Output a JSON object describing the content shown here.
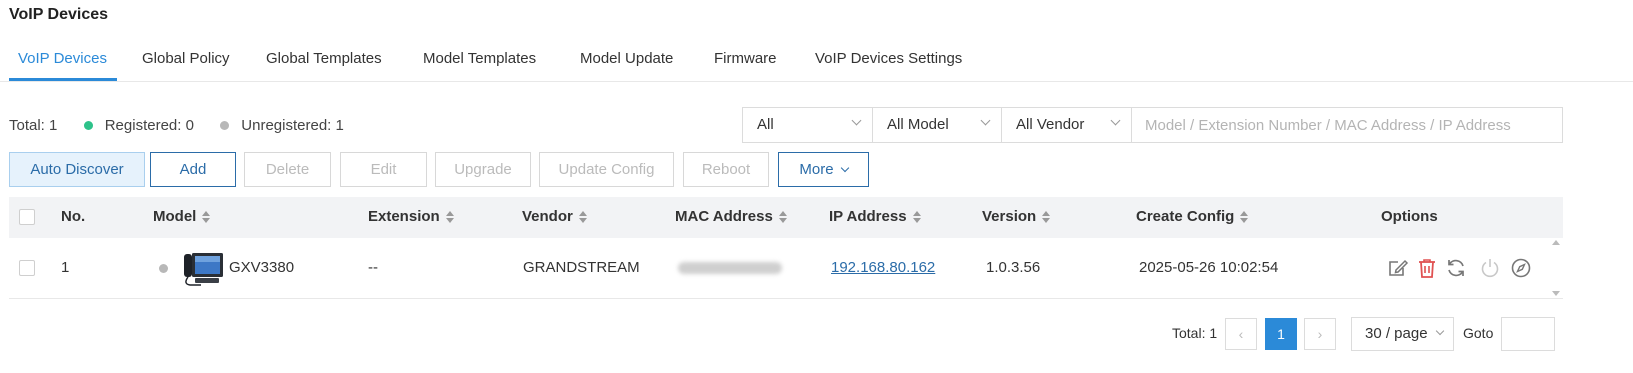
{
  "page_title": "VoIP Devices",
  "tabs": [
    {
      "label": "VoIP Devices",
      "active": true
    },
    {
      "label": "Global Policy"
    },
    {
      "label": "Global Templates"
    },
    {
      "label": "Model Templates"
    },
    {
      "label": "Model Update"
    },
    {
      "label": "Firmware"
    },
    {
      "label": "VoIP Devices Settings"
    }
  ],
  "summary": {
    "total": "Total: 1",
    "registered": "Registered: 0",
    "unregistered": "Unregistered: 1"
  },
  "filters": {
    "status": "All",
    "model": "All Model",
    "vendor": "All Vendor",
    "search_placeholder": "Model / Extension Number / MAC Address / IP Address"
  },
  "toolbar": {
    "auto_discover": "Auto Discover",
    "add": "Add",
    "delete": "Delete",
    "edit": "Edit",
    "upgrade": "Upgrade",
    "update_config": "Update Config",
    "reboot": "Reboot",
    "more": "More"
  },
  "table": {
    "columns": {
      "no": "No.",
      "model": "Model",
      "extension": "Extension",
      "vendor": "Vendor",
      "mac": "MAC Address",
      "ip": "IP Address",
      "version": "Version",
      "create_config": "Create Config",
      "options": "Options"
    },
    "rows": [
      {
        "no": "1",
        "model": "GXV3380",
        "extension": "--",
        "vendor": "GRANDSTREAM",
        "ip": "192.168.80.162",
        "version": "1.0.3.56",
        "create_config": "2025-05-26 10:02:54"
      }
    ]
  },
  "pagination": {
    "total": "Total: 1",
    "current_page": "1",
    "page_size": "30 / page",
    "goto_label": "Goto"
  },
  "colors": {
    "accent": "#2b8ad8",
    "registered": "#2ec28a",
    "unregistered": "#b8b8b8",
    "delete_icon": "#e05252"
  }
}
